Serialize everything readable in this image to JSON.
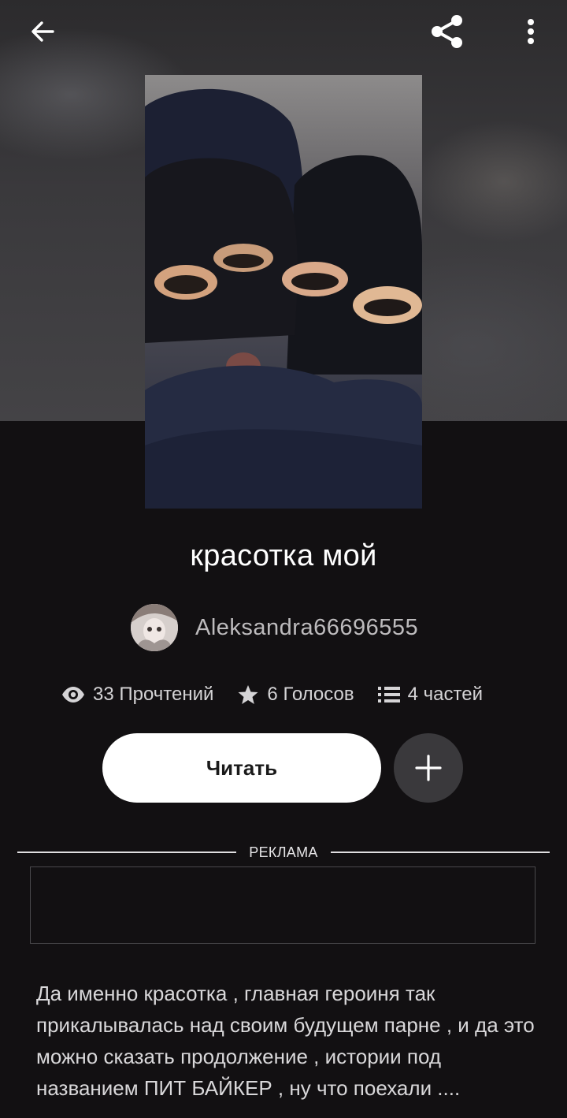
{
  "topbar": {
    "back_icon": "arrow-left-icon",
    "share_icon": "share-icon",
    "more_icon": "more-vertical-icon"
  },
  "story": {
    "title": "красотка мой",
    "author": "Aleksandra66696555",
    "description": "Да именно красотка , главная героиня так прикалывалась над своим будущем парне , и да это можно сказать продолжение , истории под названием ПИТ БАЙКЕР , ну что поехали ...."
  },
  "stats": {
    "reads": "33 Прочтений",
    "votes": "6 Голосов",
    "parts": "4 частей"
  },
  "actions": {
    "read_label": "Читать",
    "add_icon": "plus-icon"
  },
  "ad": {
    "label": "РЕКЛАМА"
  },
  "colors": {
    "background": "#121012",
    "read_button": "#ffffff",
    "add_button": "#3a393c",
    "secondary_text": "#bdbbbd"
  }
}
